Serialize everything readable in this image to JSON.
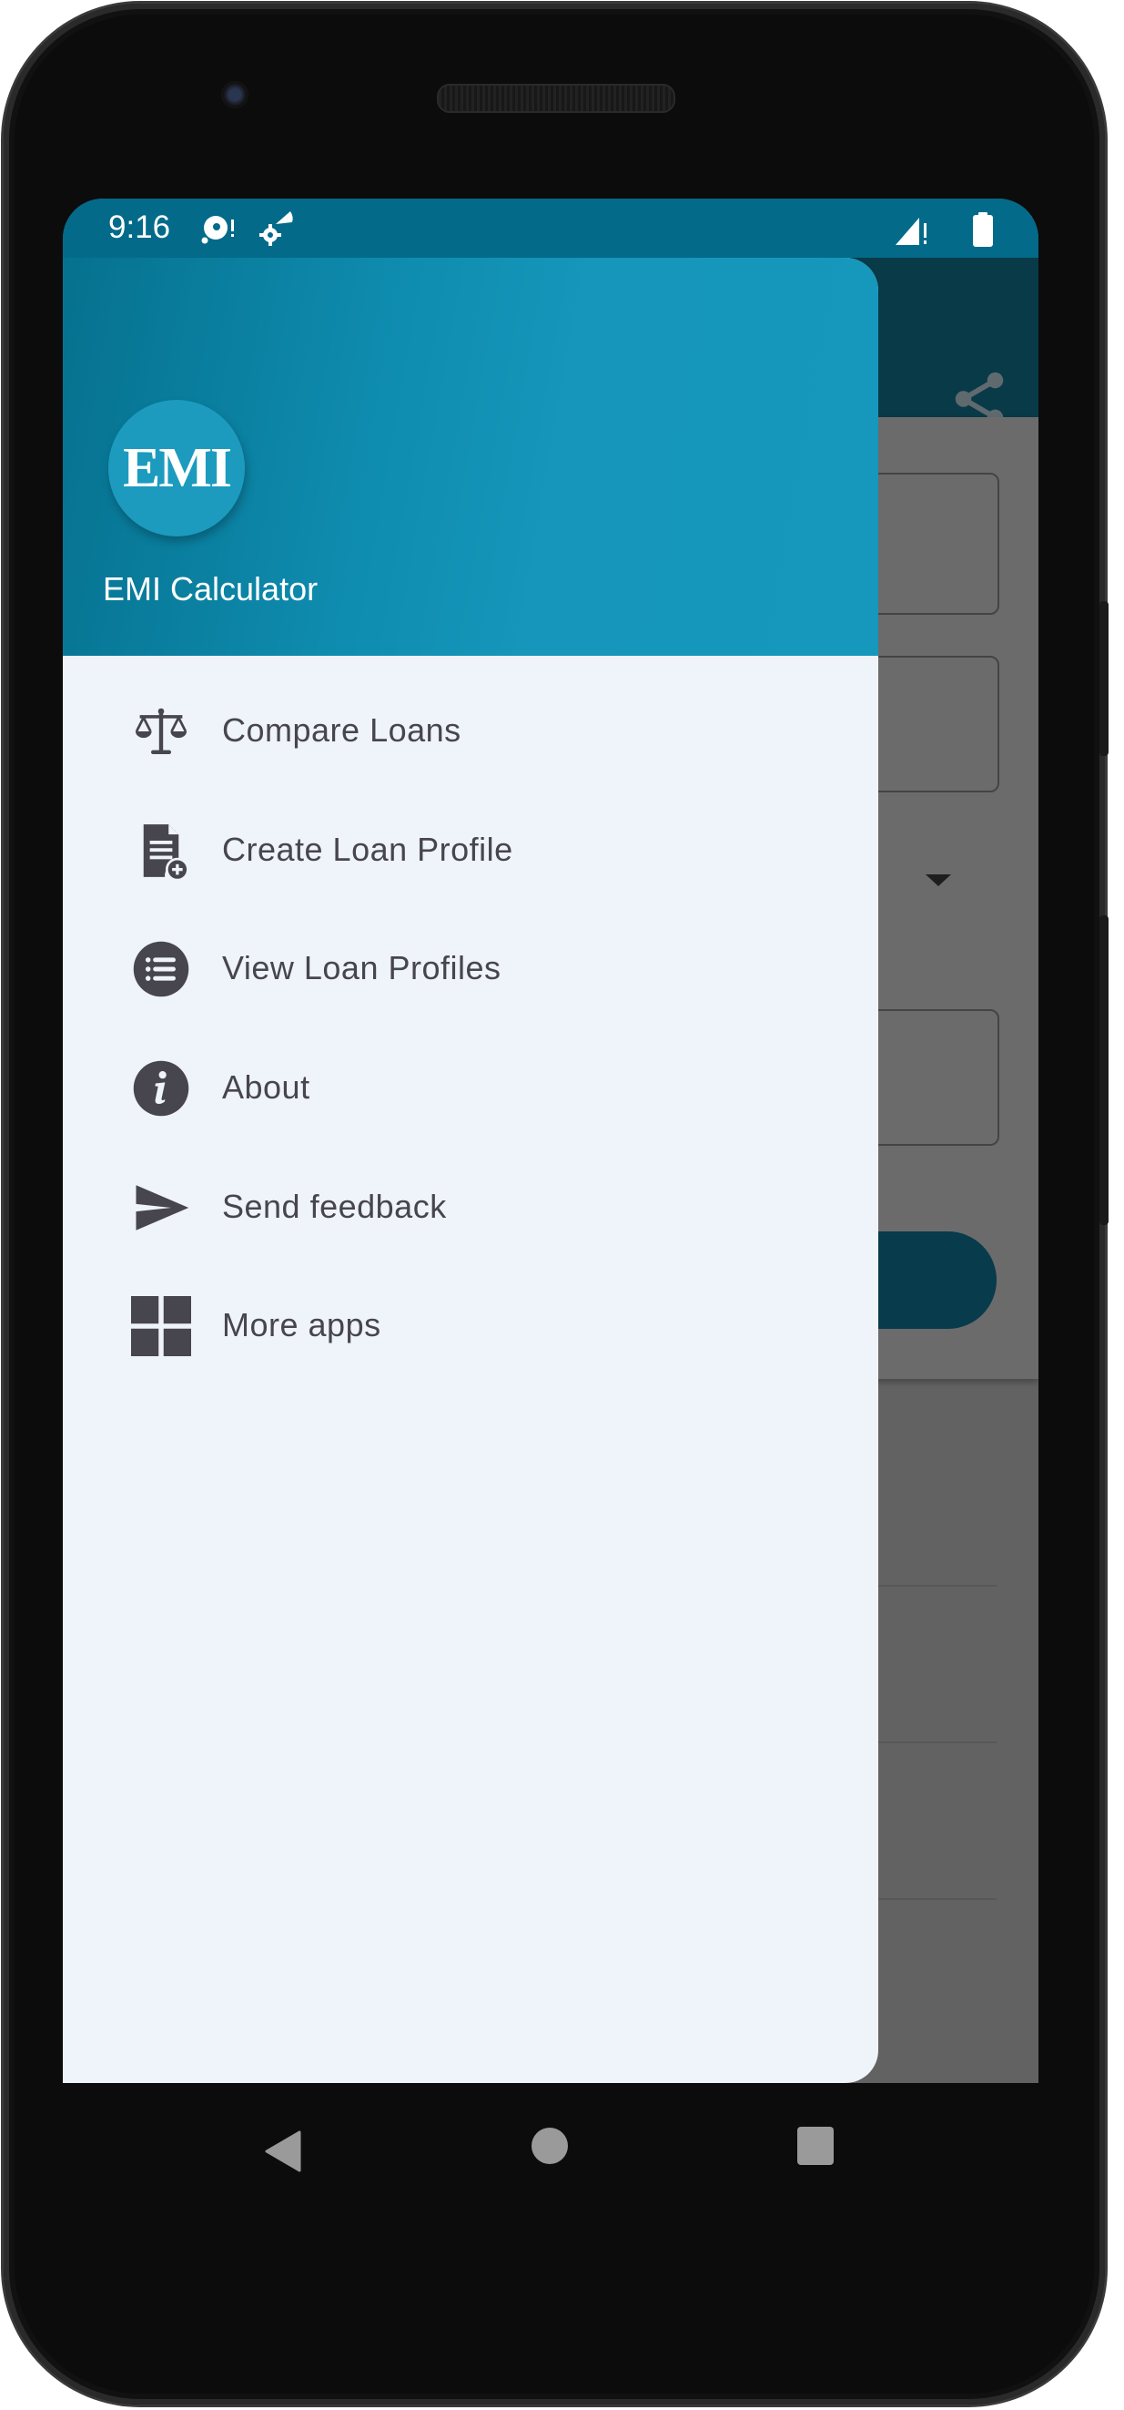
{
  "status_bar": {
    "time": "9:16",
    "left_icons": [
      "data-saver-alert-icon",
      "settings-signal-icon"
    ],
    "right_icons": [
      "cellular-signal-alert-icon",
      "battery-icon"
    ]
  },
  "drawer": {
    "app_logo_text": "EMI",
    "app_title": "EMI Calculator",
    "header_color": "#1596ba",
    "items": [
      {
        "label": "Compare Loans",
        "icon": "scale-icon"
      },
      {
        "label": "Create Loan Profile",
        "icon": "document-add-icon"
      },
      {
        "label": "View Loan Profiles",
        "icon": "list-icon"
      },
      {
        "label": "About",
        "icon": "info-icon"
      },
      {
        "label": "Send feedback",
        "icon": "send-icon"
      },
      {
        "label": "More apps",
        "icon": "grid-icon"
      }
    ]
  },
  "background_app": {
    "toolbar_icon": "share-icon",
    "toolbar_color": "#093a48"
  },
  "nav_bar": {
    "buttons": [
      "back",
      "home",
      "recents"
    ]
  }
}
